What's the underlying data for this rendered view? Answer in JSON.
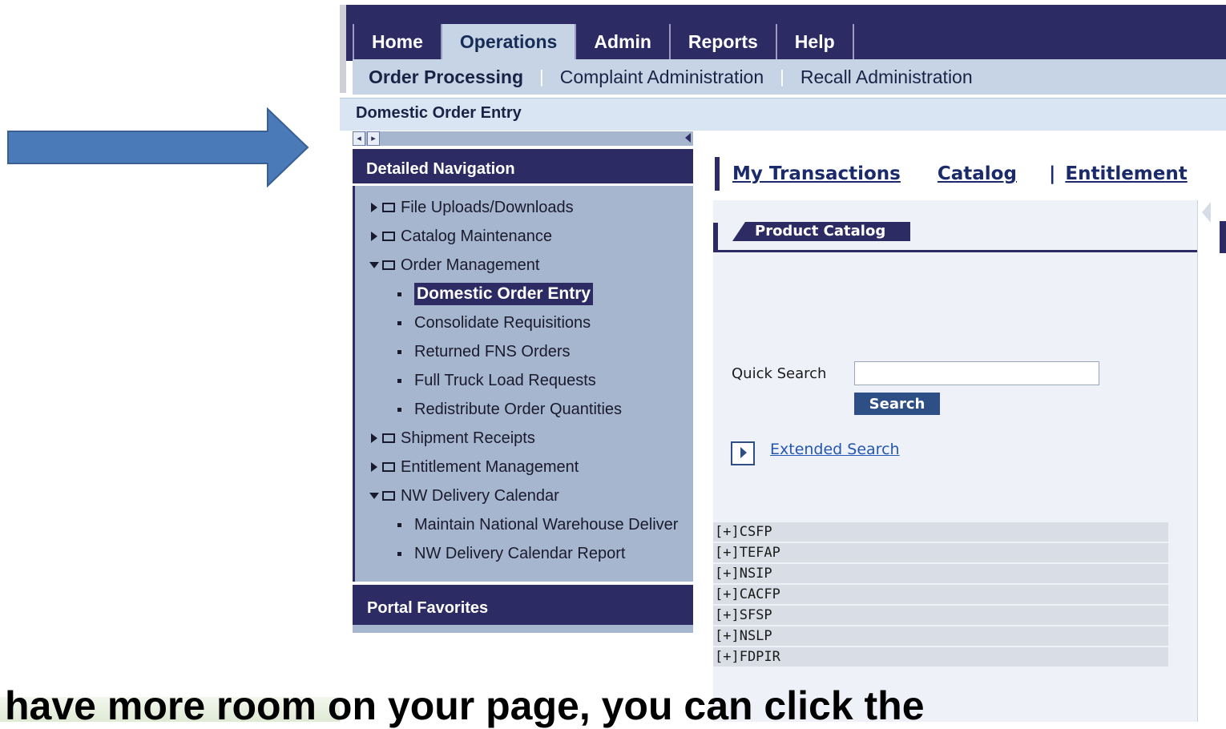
{
  "colors": {
    "arrow": "#4a7ab8",
    "nav_dark": "#2d2b63",
    "nav_light": "#c6d4e6",
    "panel": "#a6b6ce"
  },
  "top_tabs": [
    "Home",
    "Operations",
    "Admin",
    "Reports",
    "Help"
  ],
  "active_top_tab": "Operations",
  "sub_nav": [
    "Order Processing",
    "Complaint Administration",
    "Recall Administration"
  ],
  "page_title": "Domestic Order Entry",
  "detailed_navigation": {
    "title": "Detailed Navigation",
    "items": [
      {
        "label": "File Uploads/Downloads",
        "expanded": false
      },
      {
        "label": "Catalog Maintenance",
        "expanded": false
      },
      {
        "label": "Order Management",
        "expanded": true
      },
      {
        "label": "Domestic Order Entry",
        "selected": true
      },
      {
        "label": "Consolidate Requisitions"
      },
      {
        "label": "Returned FNS Orders"
      },
      {
        "label": "Full Truck Load Requests"
      },
      {
        "label": "Redistribute Order Quantities"
      },
      {
        "label": "Shipment Receipts",
        "expanded": false
      },
      {
        "label": "Entitlement Management",
        "expanded": false
      },
      {
        "label": "NW Delivery Calendar",
        "expanded": true
      },
      {
        "label": "Maintain National Warehouse Deliver"
      },
      {
        "label": "NW Delivery Calendar Report"
      }
    ]
  },
  "portal_favorites": {
    "title": "Portal Favorites"
  },
  "content_tabs": [
    "My Transactions",
    "Catalog",
    "|",
    "Entitlement"
  ],
  "catalog": {
    "header": "Product Catalog",
    "quick_search_label": "Quick Search",
    "quick_search_value": "",
    "search_button": "Search",
    "extended_search": "Extended Search",
    "programs": [
      "[+]CSFP",
      "[+]TEFAP",
      "[+]NSIP",
      "[+]CACFP",
      "[+]SFSP",
      "[+]NSLP",
      "[+]FDPIR"
    ]
  },
  "caption": "have more room on your page, you can click the"
}
